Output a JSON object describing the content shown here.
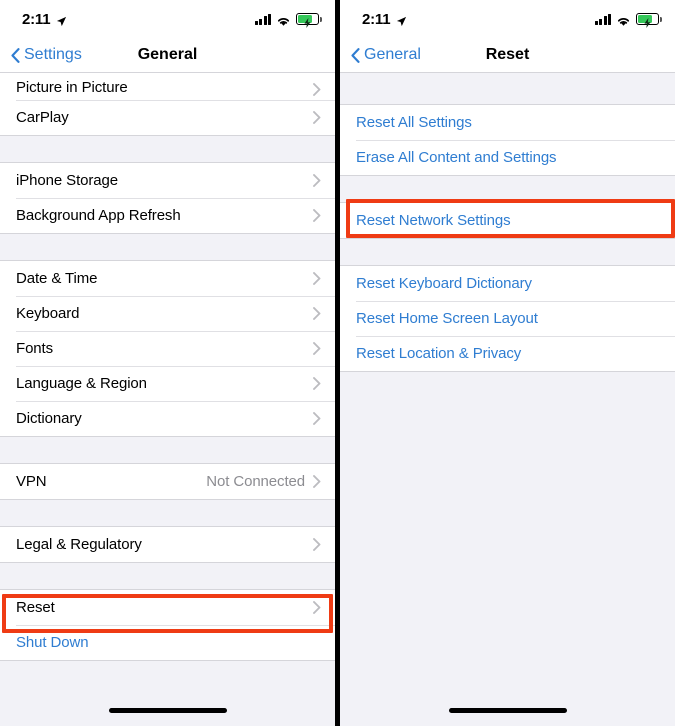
{
  "screens": [
    {
      "id": "general",
      "status_bar": {
        "time": "2:11",
        "location_icon": "location-arrow-icon",
        "cellular_icon": "cellular-signal-icon",
        "wifi_icon": "wifi-icon",
        "battery_icon": "battery-charging-icon"
      },
      "nav": {
        "back_label": "Settings",
        "title": "General"
      },
      "groups": [
        {
          "rows": [
            {
              "label": "Picture in Picture",
              "type": "chevron",
              "partial": true
            },
            {
              "label": "CarPlay",
              "type": "chevron"
            }
          ]
        },
        {
          "rows": [
            {
              "label": "iPhone Storage",
              "type": "chevron"
            },
            {
              "label": "Background App Refresh",
              "type": "chevron"
            }
          ]
        },
        {
          "rows": [
            {
              "label": "Date & Time",
              "type": "chevron"
            },
            {
              "label": "Keyboard",
              "type": "chevron"
            },
            {
              "label": "Fonts",
              "type": "chevron"
            },
            {
              "label": "Language & Region",
              "type": "chevron"
            },
            {
              "label": "Dictionary",
              "type": "chevron"
            }
          ]
        },
        {
          "rows": [
            {
              "label": "VPN",
              "type": "chevron",
              "value": "Not Connected"
            }
          ]
        },
        {
          "rows": [
            {
              "label": "Legal & Regulatory",
              "type": "chevron"
            }
          ]
        },
        {
          "rows": [
            {
              "label": "Reset",
              "type": "chevron",
              "highlighted": true
            },
            {
              "label": "Shut Down",
              "type": "link"
            }
          ]
        }
      ]
    },
    {
      "id": "reset",
      "status_bar": {
        "time": "2:11",
        "location_icon": "location-arrow-icon",
        "cellular_icon": "cellular-signal-icon",
        "wifi_icon": "wifi-icon",
        "battery_icon": "battery-charging-icon"
      },
      "nav": {
        "back_label": "General",
        "title": "Reset"
      },
      "groups": [
        {
          "rows": [
            {
              "label": "Reset All Settings",
              "type": "link"
            },
            {
              "label": "Erase All Content and Settings",
              "type": "link"
            }
          ]
        },
        {
          "rows": [
            {
              "label": "Reset Network Settings",
              "type": "link",
              "highlighted": true
            }
          ]
        },
        {
          "rows": [
            {
              "label": "Reset Keyboard Dictionary",
              "type": "link"
            },
            {
              "label": "Reset Home Screen Layout",
              "type": "link"
            },
            {
              "label": "Reset Location & Privacy",
              "type": "link"
            }
          ]
        }
      ]
    }
  ],
  "colors": {
    "accent_blue": "#2f7dd1",
    "highlight_red": "#ef3b14",
    "battery_green": "#35c759",
    "group_background": "#f2f2f7",
    "row_background": "#ffffff",
    "secondary_text": "#8c8c91"
  }
}
